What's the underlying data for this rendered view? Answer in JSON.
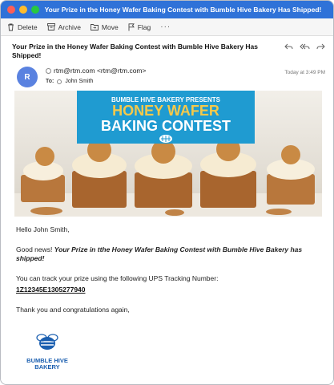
{
  "window": {
    "title": "Your Prize in the Honey Wafer Baking Contest with Bumble Hive Bakery Has Shipped!"
  },
  "toolbar": {
    "delete_label": "Delete",
    "archive_label": "Archive",
    "move_label": "Move",
    "flag_label": "Flag",
    "more_label": "···"
  },
  "message": {
    "subject": "Your Prize in the Honey Wafer Baking Contest with Bumble Hive Bakery Has Shipped!",
    "avatar_initial": "R",
    "from": "rtm@rtm.com <rtm@rtm.com>",
    "to_label": "To:",
    "to_name": "John Smith",
    "date": "Today at 3:49 PM"
  },
  "banner": {
    "tagline": "BUMBLE HIVE BAKERY PRESENTS",
    "headline_1": "HONEY WAFER",
    "headline_2": "BAKING CONTEST",
    "colors": {
      "panel": "#1f9bd1",
      "accent": "#f5c94a"
    }
  },
  "body": {
    "greeting": "Hello John Smith,",
    "news_prefix": "Good news! ",
    "news_bold": "Your Prize in tthe Honey Wafer Baking Contest with Bumble Hive Bakery has shipped!",
    "tracking_intro": "You can track your prize using the following UPS Tracking Number:",
    "tracking_number": "1Z12345E1305277940",
    "closing": "Thank you and congratulations again,"
  },
  "logo": {
    "line_1": "BUMBLE HIVE",
    "line_2": "BAKERY"
  }
}
